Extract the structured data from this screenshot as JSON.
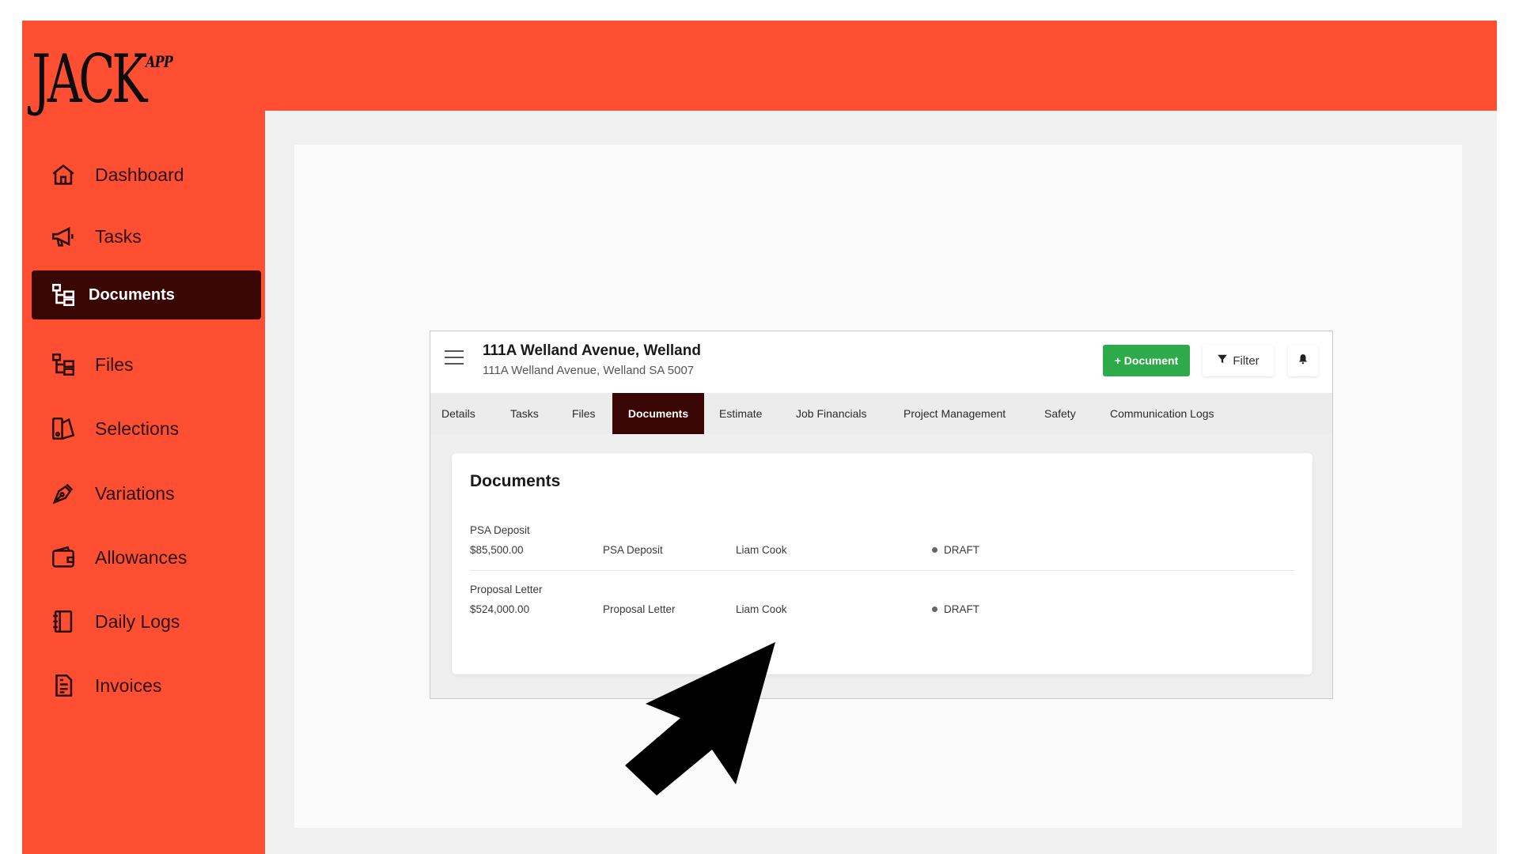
{
  "brand": {
    "logo_main": "JACK",
    "logo_sup": "APP",
    "accent": "#ff4f32",
    "active_bg": "#3a0604"
  },
  "sidebar": {
    "items": [
      {
        "label": "Dashboard",
        "icon": "home-icon"
      },
      {
        "label": "Tasks",
        "icon": "megaphone-icon"
      },
      {
        "label": "Documents",
        "icon": "documents-tree-icon",
        "active": true
      },
      {
        "label": "Files",
        "icon": "files-tree-icon"
      },
      {
        "label": "Selections",
        "icon": "selections-icon"
      },
      {
        "label": "Variations",
        "icon": "pen-nib-icon"
      },
      {
        "label": "Allowances",
        "icon": "wallet-icon"
      },
      {
        "label": "Daily Logs",
        "icon": "notebook-icon"
      },
      {
        "label": "Invoices",
        "icon": "invoice-icon"
      }
    ]
  },
  "job": {
    "title": "111A Welland Avenue, Welland",
    "address": "111A Welland Avenue, Welland SA 5007",
    "add_document_label": "+ Document",
    "filter_label": "Filter"
  },
  "tabs": [
    {
      "label": "Details"
    },
    {
      "label": "Tasks"
    },
    {
      "label": "Files"
    },
    {
      "label": "Documents",
      "active": true
    },
    {
      "label": "Estimate"
    },
    {
      "label": "Job Financials"
    },
    {
      "label": "Project Management"
    },
    {
      "label": "Safety"
    },
    {
      "label": "Communication Logs"
    }
  ],
  "documents": {
    "title": "Documents",
    "rows": [
      {
        "name": "PSA Deposit",
        "amount": "$85,500.00",
        "type": "PSA Deposit",
        "owner": "Liam Cook",
        "status": "DRAFT"
      },
      {
        "name": "Proposal Letter",
        "amount": "$524,000.00",
        "type": "Proposal Letter",
        "owner": "Liam Cook",
        "status": "DRAFT"
      }
    ]
  },
  "green_button_color": "#2faa4a"
}
